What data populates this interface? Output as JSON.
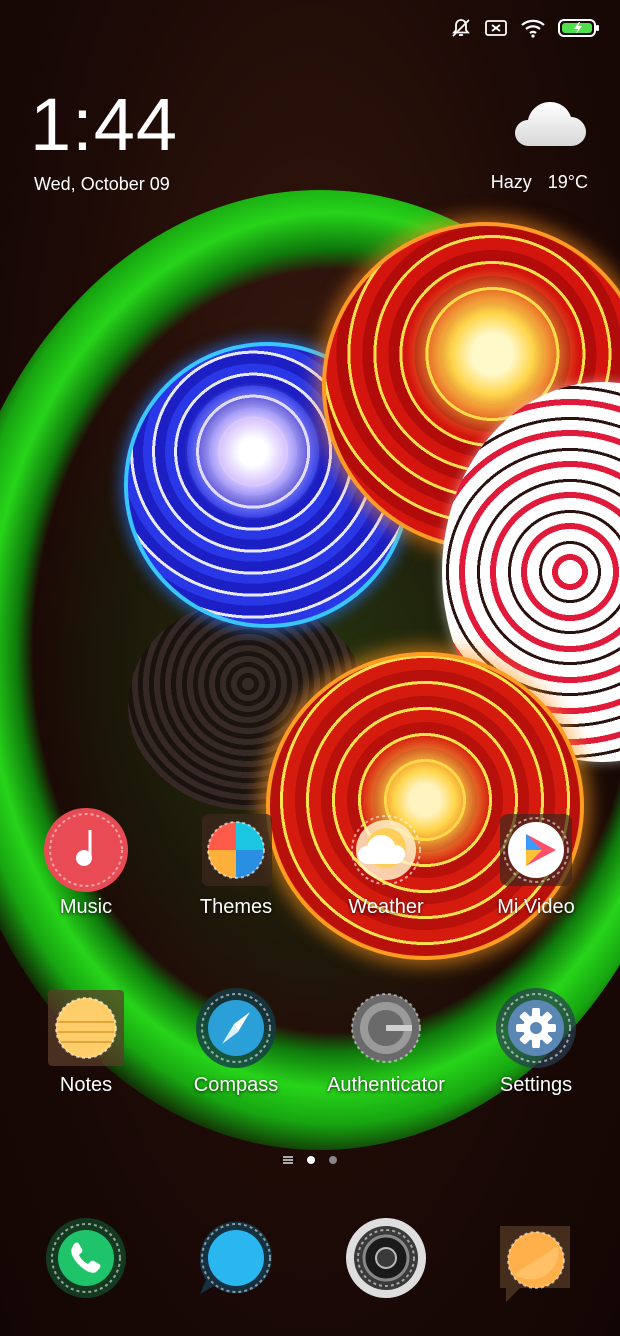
{
  "status_bar": {
    "icons": [
      "notifications-muted-icon",
      "sim-off-icon",
      "wifi-icon",
      "battery-charging-icon"
    ],
    "battery_color": "#4ee04a"
  },
  "widget": {
    "time": "1:44",
    "date": "Wed, October 09",
    "weather_condition": "Hazy",
    "temperature": "19°C",
    "weather_icon": "cloud-icon"
  },
  "apps": [
    {
      "label": "Music",
      "icon": "music-icon",
      "color": "#e94b55"
    },
    {
      "label": "Themes",
      "icon": "themes-icon",
      "color": "#ff7a59"
    },
    {
      "label": "Weather",
      "icon": "weather-icon",
      "color": "#ffcf5a"
    },
    {
      "label": "Mi Video",
      "icon": "play-icon",
      "color": "#ff5a6a"
    },
    {
      "label": "Notes",
      "icon": "notes-icon",
      "color": "#ffcd6a"
    },
    {
      "label": "Compass",
      "icon": "compass-icon",
      "color": "#2a9fd8"
    },
    {
      "label": "Authenticator",
      "icon": "authenticator-icon",
      "color": "#5a5a5a"
    },
    {
      "label": "Settings",
      "icon": "gear-icon",
      "color": "#5b87b5"
    }
  ],
  "page_indicator": {
    "pages": 2,
    "active": 1
  },
  "dock": [
    {
      "icon": "phone-icon",
      "color": "#1fc46a"
    },
    {
      "icon": "messaging-icon",
      "color": "#2ab7f0"
    },
    {
      "icon": "camera-icon",
      "color": "#444444"
    },
    {
      "icon": "browser-icon",
      "color": "#ffb04a"
    }
  ]
}
